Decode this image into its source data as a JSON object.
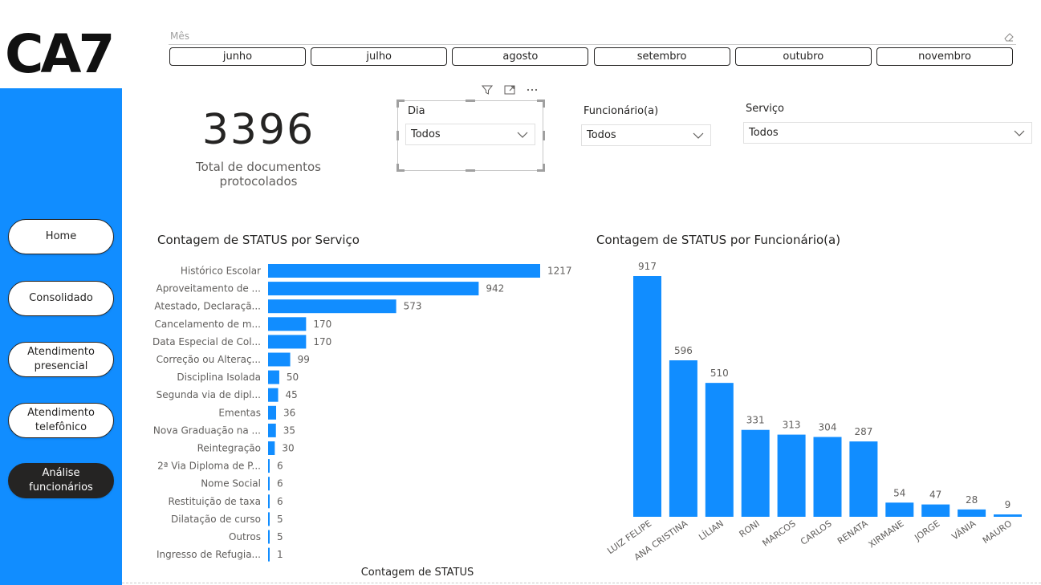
{
  "brand": {
    "logo_text": "CA7"
  },
  "nav": {
    "items": [
      {
        "label": "Home",
        "active": false
      },
      {
        "label": "Consolidado",
        "active": false
      },
      {
        "label": "Atendimento\npresencial",
        "active": false
      },
      {
        "label": "Atendimento\ntelefônico",
        "active": false
      },
      {
        "label": "Análise funcionários",
        "active": true
      }
    ]
  },
  "month_slicer": {
    "label": "Mês",
    "options": [
      "junho",
      "julho",
      "agosto",
      "setembro",
      "outubro",
      "novembro"
    ]
  },
  "kpi": {
    "value": "3396",
    "label": "Total de documentos protocolados"
  },
  "slicers": {
    "dia": {
      "title": "Dia",
      "value": "Todos"
    },
    "funcionario": {
      "title": "Funcionário(a)",
      "value": "Todos"
    },
    "servico": {
      "title": "Serviço",
      "value": "Todos"
    }
  },
  "icons": {
    "filter": "filter-icon",
    "focus": "focus-mode-icon",
    "more": "more-options-icon",
    "eraser": "eraser-icon",
    "chevron": "chevron-down-icon"
  },
  "colors": {
    "accent": "#118dff",
    "dark": "#252423"
  },
  "chart_data": [
    {
      "type": "bar",
      "orientation": "horizontal",
      "title": "Contagem de STATUS por Serviço",
      "xlabel": "Contagem de STATUS",
      "categories": [
        "Histórico Escolar",
        "Aproveitamento de ...",
        "Atestado, Declaraçã...",
        "Cancelamento de m...",
        "Data Especial de Col...",
        "Correção ou Alteraç...",
        "Disciplina Isolada",
        "Segunda via de dipl...",
        "Ementas",
        "Nova Graduação na ...",
        "Reintegração",
        "2ª Via Diploma de P...",
        "Nome Social",
        "Restituição de taxa",
        "Dilatação de curso",
        "Outros",
        "Ingresso de Refugia..."
      ],
      "values": [
        1217,
        942,
        573,
        170,
        170,
        99,
        50,
        45,
        36,
        35,
        30,
        6,
        6,
        6,
        5,
        5,
        1
      ],
      "xlim": [
        0,
        1217
      ],
      "grid": false,
      "color": "#118dff"
    },
    {
      "type": "bar",
      "orientation": "vertical",
      "title": "Contagem de STATUS por Funcionário(a)",
      "categories": [
        "LUIZ FELIPE",
        "ANA CRISTINA",
        "LÍLIAN",
        "RONI",
        "MARCOS",
        "CARLOS",
        "RENATA",
        "XIRMANE",
        "JORGE",
        "VÂNIA",
        "MAURO"
      ],
      "values": [
        917,
        596,
        510,
        331,
        313,
        304,
        287,
        54,
        47,
        28,
        9
      ],
      "ylim": [
        0,
        917
      ],
      "grid": false,
      "color": "#118dff"
    }
  ]
}
